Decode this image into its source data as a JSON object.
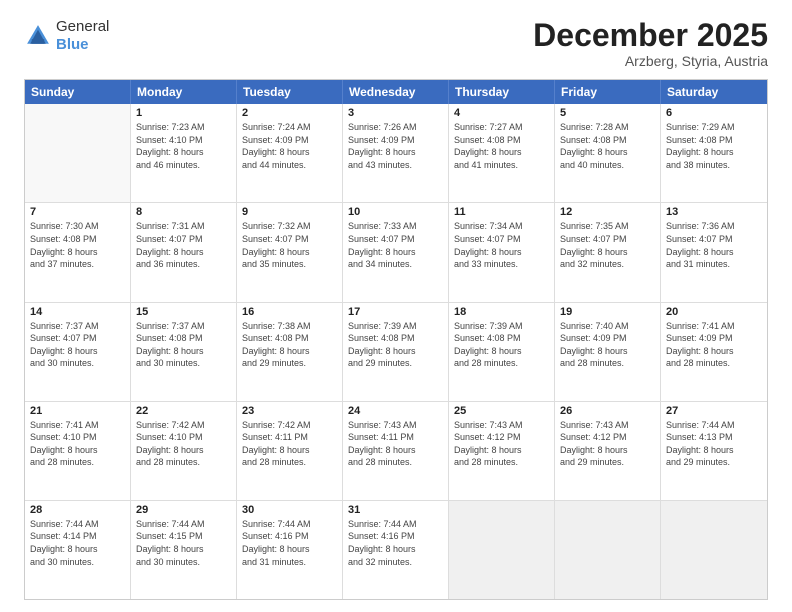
{
  "header": {
    "logo": {
      "general": "General",
      "blue": "Blue"
    },
    "title": "December 2025",
    "location": "Arzberg, Styria, Austria"
  },
  "calendar": {
    "days_of_week": [
      "Sunday",
      "Monday",
      "Tuesday",
      "Wednesday",
      "Thursday",
      "Friday",
      "Saturday"
    ],
    "weeks": [
      [
        {
          "day": "",
          "info": ""
        },
        {
          "day": "1",
          "info": "Sunrise: 7:23 AM\nSunset: 4:10 PM\nDaylight: 8 hours\nand 46 minutes."
        },
        {
          "day": "2",
          "info": "Sunrise: 7:24 AM\nSunset: 4:09 PM\nDaylight: 8 hours\nand 44 minutes."
        },
        {
          "day": "3",
          "info": "Sunrise: 7:26 AM\nSunset: 4:09 PM\nDaylight: 8 hours\nand 43 minutes."
        },
        {
          "day": "4",
          "info": "Sunrise: 7:27 AM\nSunset: 4:08 PM\nDaylight: 8 hours\nand 41 minutes."
        },
        {
          "day": "5",
          "info": "Sunrise: 7:28 AM\nSunset: 4:08 PM\nDaylight: 8 hours\nand 40 minutes."
        },
        {
          "day": "6",
          "info": "Sunrise: 7:29 AM\nSunset: 4:08 PM\nDaylight: 8 hours\nand 38 minutes."
        }
      ],
      [
        {
          "day": "7",
          "info": "Sunrise: 7:30 AM\nSunset: 4:08 PM\nDaylight: 8 hours\nand 37 minutes."
        },
        {
          "day": "8",
          "info": "Sunrise: 7:31 AM\nSunset: 4:07 PM\nDaylight: 8 hours\nand 36 minutes."
        },
        {
          "day": "9",
          "info": "Sunrise: 7:32 AM\nSunset: 4:07 PM\nDaylight: 8 hours\nand 35 minutes."
        },
        {
          "day": "10",
          "info": "Sunrise: 7:33 AM\nSunset: 4:07 PM\nDaylight: 8 hours\nand 34 minutes."
        },
        {
          "day": "11",
          "info": "Sunrise: 7:34 AM\nSunset: 4:07 PM\nDaylight: 8 hours\nand 33 minutes."
        },
        {
          "day": "12",
          "info": "Sunrise: 7:35 AM\nSunset: 4:07 PM\nDaylight: 8 hours\nand 32 minutes."
        },
        {
          "day": "13",
          "info": "Sunrise: 7:36 AM\nSunset: 4:07 PM\nDaylight: 8 hours\nand 31 minutes."
        }
      ],
      [
        {
          "day": "14",
          "info": "Sunrise: 7:37 AM\nSunset: 4:07 PM\nDaylight: 8 hours\nand 30 minutes."
        },
        {
          "day": "15",
          "info": "Sunrise: 7:37 AM\nSunset: 4:08 PM\nDaylight: 8 hours\nand 30 minutes."
        },
        {
          "day": "16",
          "info": "Sunrise: 7:38 AM\nSunset: 4:08 PM\nDaylight: 8 hours\nand 29 minutes."
        },
        {
          "day": "17",
          "info": "Sunrise: 7:39 AM\nSunset: 4:08 PM\nDaylight: 8 hours\nand 29 minutes."
        },
        {
          "day": "18",
          "info": "Sunrise: 7:39 AM\nSunset: 4:08 PM\nDaylight: 8 hours\nand 28 minutes."
        },
        {
          "day": "19",
          "info": "Sunrise: 7:40 AM\nSunset: 4:09 PM\nDaylight: 8 hours\nand 28 minutes."
        },
        {
          "day": "20",
          "info": "Sunrise: 7:41 AM\nSunset: 4:09 PM\nDaylight: 8 hours\nand 28 minutes."
        }
      ],
      [
        {
          "day": "21",
          "info": "Sunrise: 7:41 AM\nSunset: 4:10 PM\nDaylight: 8 hours\nand 28 minutes."
        },
        {
          "day": "22",
          "info": "Sunrise: 7:42 AM\nSunset: 4:10 PM\nDaylight: 8 hours\nand 28 minutes."
        },
        {
          "day": "23",
          "info": "Sunrise: 7:42 AM\nSunset: 4:11 PM\nDaylight: 8 hours\nand 28 minutes."
        },
        {
          "day": "24",
          "info": "Sunrise: 7:43 AM\nSunset: 4:11 PM\nDaylight: 8 hours\nand 28 minutes."
        },
        {
          "day": "25",
          "info": "Sunrise: 7:43 AM\nSunset: 4:12 PM\nDaylight: 8 hours\nand 28 minutes."
        },
        {
          "day": "26",
          "info": "Sunrise: 7:43 AM\nSunset: 4:12 PM\nDaylight: 8 hours\nand 29 minutes."
        },
        {
          "day": "27",
          "info": "Sunrise: 7:44 AM\nSunset: 4:13 PM\nDaylight: 8 hours\nand 29 minutes."
        }
      ],
      [
        {
          "day": "28",
          "info": "Sunrise: 7:44 AM\nSunset: 4:14 PM\nDaylight: 8 hours\nand 30 minutes."
        },
        {
          "day": "29",
          "info": "Sunrise: 7:44 AM\nSunset: 4:15 PM\nDaylight: 8 hours\nand 30 minutes."
        },
        {
          "day": "30",
          "info": "Sunrise: 7:44 AM\nSunset: 4:16 PM\nDaylight: 8 hours\nand 31 minutes."
        },
        {
          "day": "31",
          "info": "Sunrise: 7:44 AM\nSunset: 4:16 PM\nDaylight: 8 hours\nand 32 minutes."
        },
        {
          "day": "",
          "info": ""
        },
        {
          "day": "",
          "info": ""
        },
        {
          "day": "",
          "info": ""
        }
      ]
    ]
  }
}
